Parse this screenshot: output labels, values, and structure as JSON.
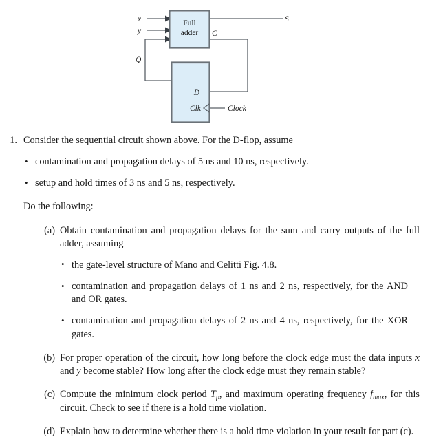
{
  "figure": {
    "caption_alt": "Sequential circuit: full adder with D flip-flop feedback",
    "blocks": [
      {
        "id": "full-adder",
        "line1": "Full",
        "line2": "adder"
      },
      {
        "id": "d-flip-flop",
        "line1": "",
        "line2": ""
      }
    ],
    "labels": {
      "input_x": "x",
      "input_y": "y",
      "feedback_q": "Q",
      "output_s": "S",
      "carry_c": "C",
      "dff_d": "D",
      "dff_clk": "Clk",
      "clock_source": "Clock"
    },
    "colors": {
      "block_fill": "#dcedf8",
      "block_border": "#6b7278",
      "wire": "#5a6168"
    }
  },
  "problem": {
    "number": "1.",
    "lead": "Consider the sequential circuit shown above.  For the D-flop, assume",
    "assumptions": [
      "contamination and propagation delays of 5 ns and 10 ns, respectively.",
      "setup and hold times of 3 ns and 5 ns, respectively."
    ],
    "do_following": "Do the following:",
    "parts": [
      {
        "label": "(a)",
        "text": "Obtain contamination and propagation delays for the sum and carry outputs of the full adder, assuming",
        "subitems": [
          "the gate-level structure of Mano and Celitti Fig. 4.8.",
          "contamination and propagation delays of 1 ns and 2 ns, respectively, for the AND and OR gates.",
          "contamination and propagation delays of 2 ns and 4 ns, respectively, for the XOR gates."
        ]
      },
      {
        "label": "(b)",
        "text_part1": "For proper operation of the circuit, how long before the clock edge must the data inputs ",
        "math_x": "x",
        "text_and": " and ",
        "math_y": "y",
        "text_part2": " become stable?  How long after the clock edge must they remain stable?"
      },
      {
        "label": "(c)",
        "text_part1": "Compute the minimum clock period ",
        "math_T": "T",
        "math_T_sub": "p",
        "text_part2": ", and maximum operating frequency ",
        "math_f": "f",
        "math_f_sub": "max",
        "text_part3": ", for this circuit.  Check to see if there is a hold time violation."
      },
      {
        "label": "(d)",
        "text": "Explain how to determine whether there is a hold time violation in your result for part (c)."
      }
    ]
  }
}
